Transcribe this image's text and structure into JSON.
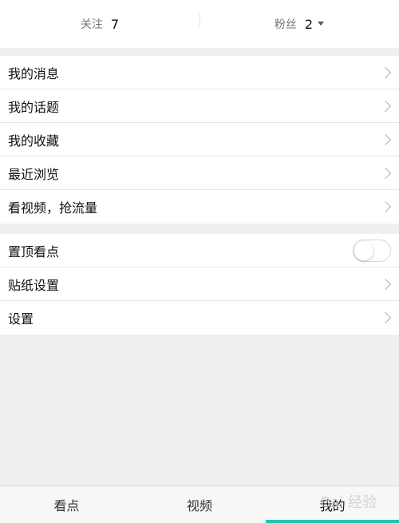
{
  "stats": {
    "follow_label": "关注",
    "follow_value": "7",
    "fans_label": "粉丝",
    "fans_value": "2"
  },
  "menu_group_1": [
    {
      "label": "我的消息",
      "icon": "chevron-right-icon"
    },
    {
      "label": "我的话题",
      "icon": "chevron-right-icon"
    },
    {
      "label": "我的收藏",
      "icon": "chevron-right-icon"
    },
    {
      "label": "最近浏览",
      "icon": "chevron-right-icon"
    },
    {
      "label": "看视频，抢流量",
      "icon": "chevron-right-icon"
    }
  ],
  "menu_group_2": {
    "pin_label": "置顶看点",
    "pin_toggle_on": false,
    "sticker_label": "贴纸设置",
    "settings_label": "设置"
  },
  "tabbar": {
    "tabs": [
      "看点",
      "视频",
      "我的"
    ],
    "active_index": 2,
    "accent_color": "#1ec6b0"
  },
  "watermark": "Bai 经验"
}
